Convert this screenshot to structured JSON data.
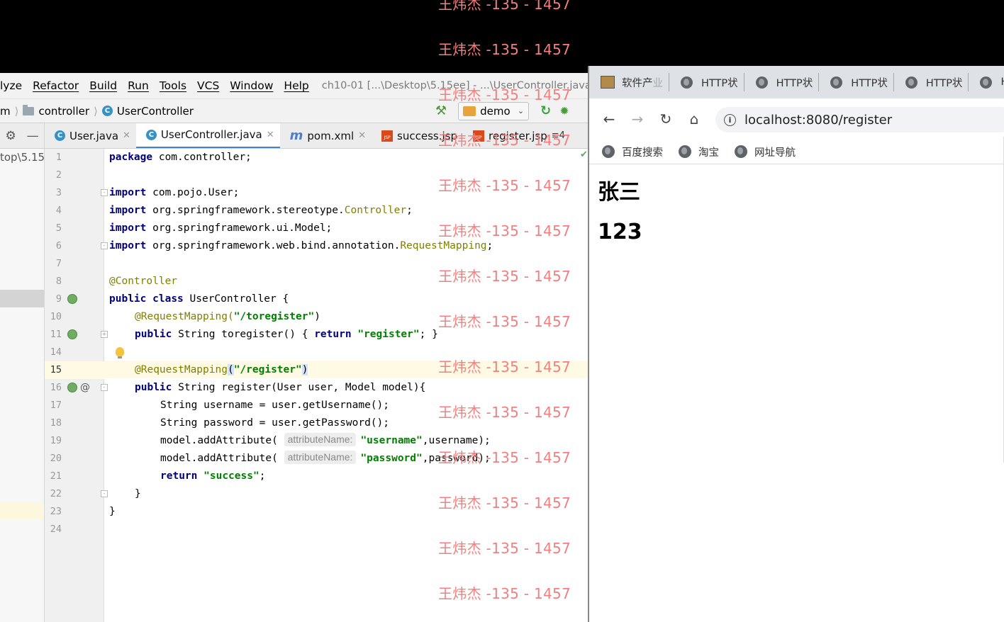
{
  "ide": {
    "menu": [
      "lyze",
      "Refactor",
      "Build",
      "Run",
      "Tools",
      "VCS",
      "Window",
      "Help"
    ],
    "window_title": "ch10-01 [...\\Desktop\\5.15ee] - ...\\UserController.java",
    "breadcrumb": {
      "prefix": "m",
      "folder": "controller",
      "class": "UserController"
    },
    "run_config": "demo",
    "tabs": [
      {
        "label": "User.java",
        "icon": "class-icon"
      },
      {
        "label": "UserController.java",
        "icon": "class-icon",
        "active": true
      },
      {
        "label": "pom.xml",
        "icon": "maven-icon"
      },
      {
        "label": "success.jsp",
        "icon": "jsp-icon"
      },
      {
        "label": "register.jsp",
        "icon": "jsp-icon"
      }
    ],
    "tabs_more": "≡4",
    "project_path": "top\\5.15",
    "line_numbers": [
      "1",
      "2",
      "3",
      "4",
      "5",
      "6",
      "7",
      "8",
      "9",
      "10",
      "11",
      "14",
      "15",
      "16",
      "17",
      "18",
      "19",
      "20",
      "21",
      "22",
      "23",
      "24"
    ],
    "code": {
      "l1": [
        "package",
        " com.controller;"
      ],
      "l3": [
        "import",
        " com.pojo.User;"
      ],
      "l4": [
        "import",
        " org.springframework.stereotype.",
        "Controller",
        ";"
      ],
      "l5": [
        "import",
        " org.springframework.ui.Model;"
      ],
      "l6": [
        "import",
        " org.springframework.web.bind.annotation.",
        "RequestMapping",
        ";"
      ],
      "l8": "@Controller",
      "l9": [
        "public",
        " ",
        "class",
        " UserController {"
      ],
      "l10": [
        "@RequestMapping(",
        "\"/toregister\"",
        ")"
      ],
      "l11": [
        "public",
        " String ",
        "toregister",
        "() { ",
        "return",
        " ",
        "\"register\"",
        "; }"
      ],
      "l15": [
        "@RequestMapping",
        "(",
        "\"/register\"",
        ")"
      ],
      "l16": [
        "public",
        " String register(User user, Model model){"
      ],
      "l17": "String username = user.getUsername();",
      "l18": "String password = user.getPassword();",
      "l19": [
        "model.addAttribute( ",
        "attributeName:",
        "\"username\"",
        ",username);"
      ],
      "l20": [
        "model.addAttribute( ",
        "attributeName:",
        "\"password\"",
        ",password);"
      ],
      "l21": [
        "return",
        " ",
        "\"success\"",
        ";"
      ],
      "l22": "}",
      "l23": "}"
    }
  },
  "browser": {
    "tabs": [
      {
        "label": "软件产",
        "fade": "业",
        "icon": "page-favicon"
      },
      {
        "label": "HTTP状",
        "icon": "globe-icon"
      },
      {
        "label": "HTTP状",
        "icon": "globe-icon"
      },
      {
        "label": "HTTP状",
        "icon": "globe-icon"
      },
      {
        "label": "HTTP状",
        "icon": "globe-icon"
      },
      {
        "label": "HT",
        "icon": "globe-icon"
      }
    ],
    "url": "localhost:8080/register",
    "bookmarks": [
      "百度搜索",
      "淘宝",
      "网址导航"
    ],
    "page": {
      "username": "张三",
      "password": "123"
    }
  },
  "watermark": "王炜杰 -135 - 1457",
  "colors": {
    "keyword": "#000080",
    "string": "#008000",
    "annotation": "#808000",
    "watermark": "#f28080"
  }
}
